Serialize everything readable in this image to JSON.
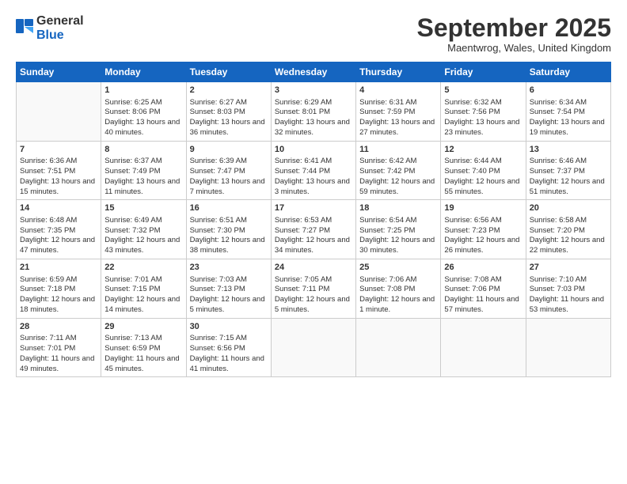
{
  "logo": {
    "line1": "General",
    "line2": "Blue"
  },
  "title": "September 2025",
  "location": "Maentwrog, Wales, United Kingdom",
  "weekdays": [
    "Sunday",
    "Monday",
    "Tuesday",
    "Wednesday",
    "Thursday",
    "Friday",
    "Saturday"
  ],
  "weeks": [
    [
      {
        "day": "",
        "sunrise": "",
        "sunset": "",
        "daylight": ""
      },
      {
        "day": "1",
        "sunrise": "Sunrise: 6:25 AM",
        "sunset": "Sunset: 8:06 PM",
        "daylight": "Daylight: 13 hours and 40 minutes."
      },
      {
        "day": "2",
        "sunrise": "Sunrise: 6:27 AM",
        "sunset": "Sunset: 8:03 PM",
        "daylight": "Daylight: 13 hours and 36 minutes."
      },
      {
        "day": "3",
        "sunrise": "Sunrise: 6:29 AM",
        "sunset": "Sunset: 8:01 PM",
        "daylight": "Daylight: 13 hours and 32 minutes."
      },
      {
        "day": "4",
        "sunrise": "Sunrise: 6:31 AM",
        "sunset": "Sunset: 7:59 PM",
        "daylight": "Daylight: 13 hours and 27 minutes."
      },
      {
        "day": "5",
        "sunrise": "Sunrise: 6:32 AM",
        "sunset": "Sunset: 7:56 PM",
        "daylight": "Daylight: 13 hours and 23 minutes."
      },
      {
        "day": "6",
        "sunrise": "Sunrise: 6:34 AM",
        "sunset": "Sunset: 7:54 PM",
        "daylight": "Daylight: 13 hours and 19 minutes."
      }
    ],
    [
      {
        "day": "7",
        "sunrise": "Sunrise: 6:36 AM",
        "sunset": "Sunset: 7:51 PM",
        "daylight": "Daylight: 13 hours and 15 minutes."
      },
      {
        "day": "8",
        "sunrise": "Sunrise: 6:37 AM",
        "sunset": "Sunset: 7:49 PM",
        "daylight": "Daylight: 13 hours and 11 minutes."
      },
      {
        "day": "9",
        "sunrise": "Sunrise: 6:39 AM",
        "sunset": "Sunset: 7:47 PM",
        "daylight": "Daylight: 13 hours and 7 minutes."
      },
      {
        "day": "10",
        "sunrise": "Sunrise: 6:41 AM",
        "sunset": "Sunset: 7:44 PM",
        "daylight": "Daylight: 13 hours and 3 minutes."
      },
      {
        "day": "11",
        "sunrise": "Sunrise: 6:42 AM",
        "sunset": "Sunset: 7:42 PM",
        "daylight": "Daylight: 12 hours and 59 minutes."
      },
      {
        "day": "12",
        "sunrise": "Sunrise: 6:44 AM",
        "sunset": "Sunset: 7:40 PM",
        "daylight": "Daylight: 12 hours and 55 minutes."
      },
      {
        "day": "13",
        "sunrise": "Sunrise: 6:46 AM",
        "sunset": "Sunset: 7:37 PM",
        "daylight": "Daylight: 12 hours and 51 minutes."
      }
    ],
    [
      {
        "day": "14",
        "sunrise": "Sunrise: 6:48 AM",
        "sunset": "Sunset: 7:35 PM",
        "daylight": "Daylight: 12 hours and 47 minutes."
      },
      {
        "day": "15",
        "sunrise": "Sunrise: 6:49 AM",
        "sunset": "Sunset: 7:32 PM",
        "daylight": "Daylight: 12 hours and 43 minutes."
      },
      {
        "day": "16",
        "sunrise": "Sunrise: 6:51 AM",
        "sunset": "Sunset: 7:30 PM",
        "daylight": "Daylight: 12 hours and 38 minutes."
      },
      {
        "day": "17",
        "sunrise": "Sunrise: 6:53 AM",
        "sunset": "Sunset: 7:27 PM",
        "daylight": "Daylight: 12 hours and 34 minutes."
      },
      {
        "day": "18",
        "sunrise": "Sunrise: 6:54 AM",
        "sunset": "Sunset: 7:25 PM",
        "daylight": "Daylight: 12 hours and 30 minutes."
      },
      {
        "day": "19",
        "sunrise": "Sunrise: 6:56 AM",
        "sunset": "Sunset: 7:23 PM",
        "daylight": "Daylight: 12 hours and 26 minutes."
      },
      {
        "day": "20",
        "sunrise": "Sunrise: 6:58 AM",
        "sunset": "Sunset: 7:20 PM",
        "daylight": "Daylight: 12 hours and 22 minutes."
      }
    ],
    [
      {
        "day": "21",
        "sunrise": "Sunrise: 6:59 AM",
        "sunset": "Sunset: 7:18 PM",
        "daylight": "Daylight: 12 hours and 18 minutes."
      },
      {
        "day": "22",
        "sunrise": "Sunrise: 7:01 AM",
        "sunset": "Sunset: 7:15 PM",
        "daylight": "Daylight: 12 hours and 14 minutes."
      },
      {
        "day": "23",
        "sunrise": "Sunrise: 7:03 AM",
        "sunset": "Sunset: 7:13 PM",
        "daylight": "Daylight: 12 hours and 5 minutes."
      },
      {
        "day": "24",
        "sunrise": "Sunrise: 7:05 AM",
        "sunset": "Sunset: 7:11 PM",
        "daylight": "Daylight: 12 hours and 5 minutes."
      },
      {
        "day": "25",
        "sunrise": "Sunrise: 7:06 AM",
        "sunset": "Sunset: 7:08 PM",
        "daylight": "Daylight: 12 hours and 1 minute."
      },
      {
        "day": "26",
        "sunrise": "Sunrise: 7:08 AM",
        "sunset": "Sunset: 7:06 PM",
        "daylight": "Daylight: 11 hours and 57 minutes."
      },
      {
        "day": "27",
        "sunrise": "Sunrise: 7:10 AM",
        "sunset": "Sunset: 7:03 PM",
        "daylight": "Daylight: 11 hours and 53 minutes."
      }
    ],
    [
      {
        "day": "28",
        "sunrise": "Sunrise: 7:11 AM",
        "sunset": "Sunset: 7:01 PM",
        "daylight": "Daylight: 11 hours and 49 minutes."
      },
      {
        "day": "29",
        "sunrise": "Sunrise: 7:13 AM",
        "sunset": "Sunset: 6:59 PM",
        "daylight": "Daylight: 11 hours and 45 minutes."
      },
      {
        "day": "30",
        "sunrise": "Sunrise: 7:15 AM",
        "sunset": "Sunset: 6:56 PM",
        "daylight": "Daylight: 11 hours and 41 minutes."
      },
      {
        "day": "",
        "sunrise": "",
        "sunset": "",
        "daylight": ""
      },
      {
        "day": "",
        "sunrise": "",
        "sunset": "",
        "daylight": ""
      },
      {
        "day": "",
        "sunrise": "",
        "sunset": "",
        "daylight": ""
      },
      {
        "day": "",
        "sunrise": "",
        "sunset": "",
        "daylight": ""
      }
    ]
  ]
}
